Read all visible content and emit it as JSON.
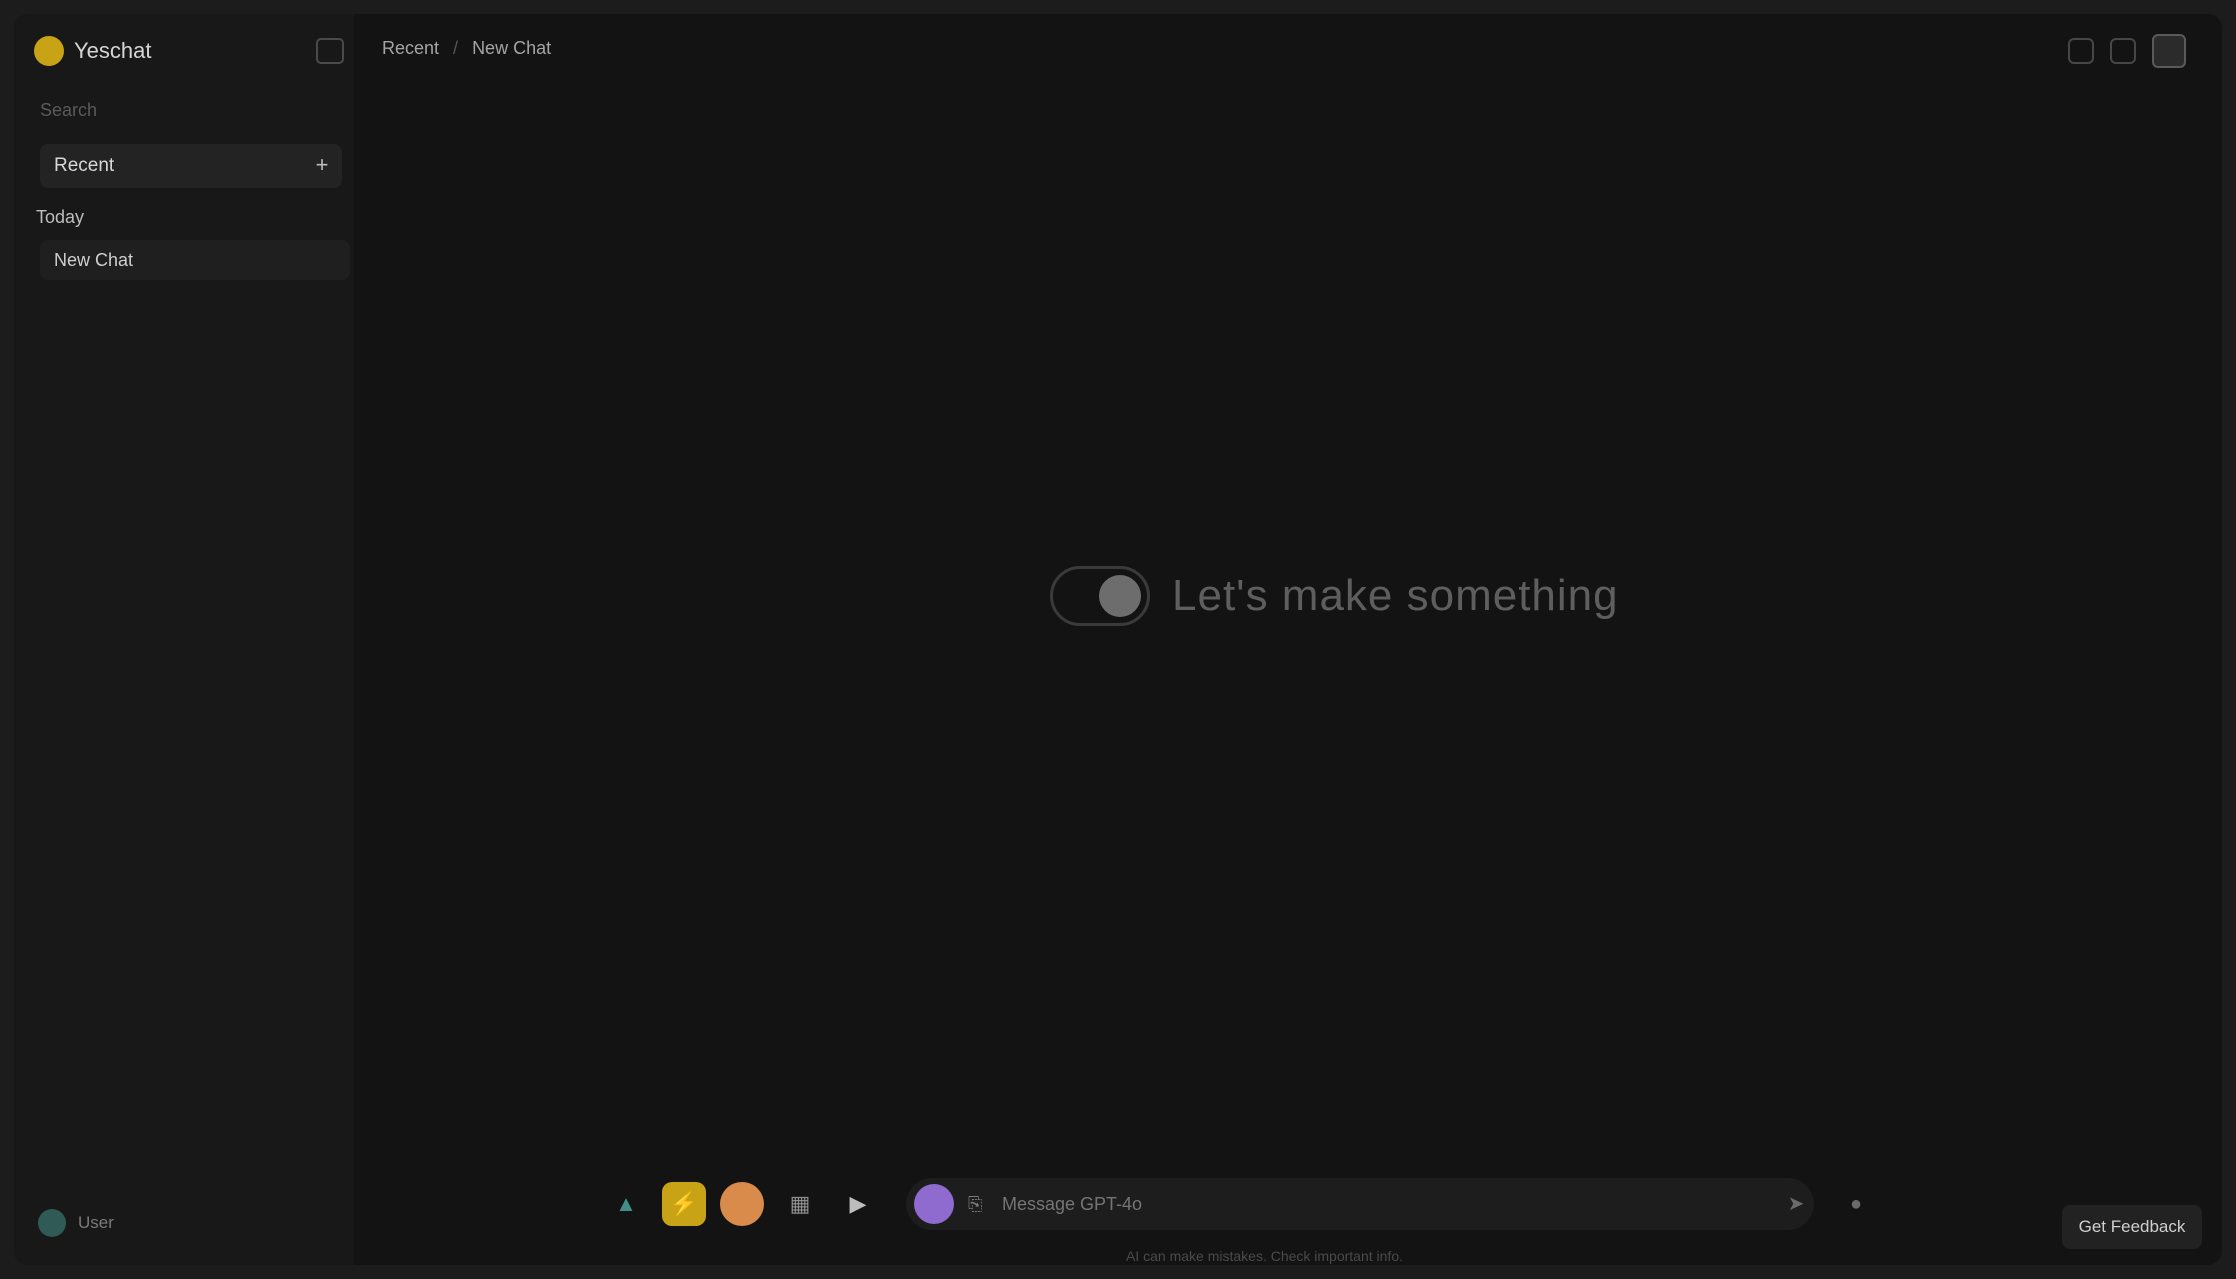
{
  "app": {
    "brand_name": "Yeschat",
    "accent": "#c9a316"
  },
  "sidebar": {
    "search_placeholder": "Search",
    "section_label": "Recent",
    "section_plus": "+",
    "group_label": "Today",
    "chat_items": [
      {
        "label": "New Chat"
      }
    ],
    "user_name": "User"
  },
  "header": {
    "breadcrumb": [
      "Recent",
      "New Chat"
    ]
  },
  "main": {
    "hero_text": "Let's make something"
  },
  "composer": {
    "placeholder": "Message GPT-4o",
    "send_icon": "arrow-up-icon",
    "extra_icon": "mic-icon",
    "model_color": "#8f6bd0"
  },
  "footer": {
    "disclaimer": "AI can make mistakes. Check important info.",
    "feedback_label": "Get Feedback"
  }
}
